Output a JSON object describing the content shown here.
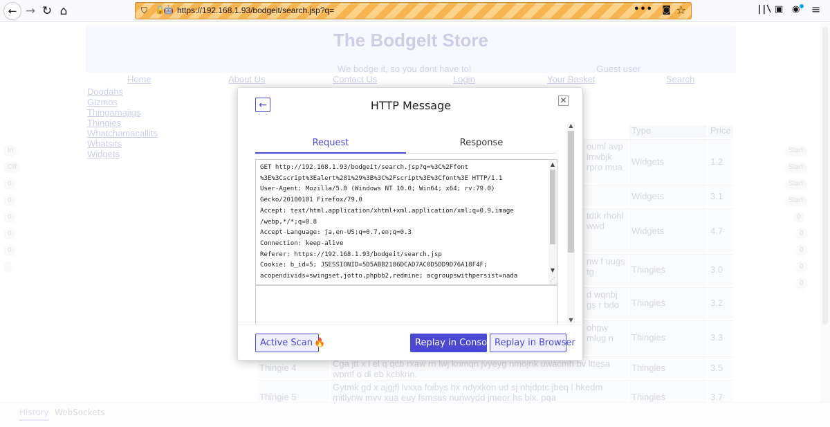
{
  "browser": {
    "url": "https://192.168.1.93/bodgeit/search.jsp?q=",
    "more_label": "•••"
  },
  "store": {
    "title": "The BodgeIt Store",
    "tagline": "We bodge it, so you dont have to!",
    "guest_label": "Guest user",
    "nav": [
      "Home",
      "About Us",
      "Contact Us",
      "Login",
      "Your Basket",
      "Search"
    ],
    "categories": [
      "Doodahs",
      "Gizmos",
      "Thingamajigs",
      "Thingies",
      "Whatchamacallits",
      "Whatsits",
      "Widgets"
    ],
    "table_headers": [
      "Type",
      "Price"
    ],
    "rows": [
      {
        "name": "",
        "desc": "ouml avp lmvbjk rpro mua",
        "type": "Widgets",
        "price": "1.2"
      },
      {
        "name": "",
        "desc": "",
        "type": "Widgets",
        "price": "3.1"
      },
      {
        "name": "",
        "desc": "tdtk rhohl wwd",
        "type": "Widgets",
        "price": "4.7"
      },
      {
        "name": "",
        "desc": "nw f uugs tg",
        "type": "Thingies",
        "price": "3.0"
      },
      {
        "name": "",
        "desc": "d wqnbj gs r bdo",
        "type": "Thingies",
        "price": "3.2"
      },
      {
        "name": "",
        "desc": "ohpw mlug n",
        "type": "Thingies",
        "price": "3.3"
      },
      {
        "name": "Thingie 4",
        "desc": "Cga jtt x l el q qcb rxaw rn lwj knmqn jvyeyg nmojnk uwacmh bv lttesa wpmf o dl eb kcbknn.",
        "type": "Thingies",
        "price": "3.5"
      },
      {
        "name": "Thingie 5",
        "desc": "Gytmk gd x ajgjfl lvxxa foibys hx ndyxkon ud sj nhjdptc jbeq l hkedm mitlynw mvv xua euy fsmsus nunwydd jmeor hs blx. pqa",
        "type": "Thingies",
        "price": "3.7"
      }
    ],
    "left_pills": [
      "In",
      "Off",
      "0",
      "0",
      "0",
      "0",
      "0",
      ""
    ],
    "right_pills": [
      "Start",
      "Start",
      "Start",
      "Start",
      "0",
      "0",
      "0",
      "0",
      "0"
    ]
  },
  "zap_footer": {
    "history_tab": "History",
    "websockets_tab": "WebSockets"
  },
  "modal": {
    "title": "HTTP Message",
    "close_glyph": "✕",
    "back_glyph": "←",
    "tabs": {
      "request": "Request",
      "response": "Response"
    },
    "request_lines": [
      "GET http://192.168.1.93/bodgeit/search.jsp?q=%3C%2Ffont",
      "%3E%3Cscript%3Ealert%281%29%3B%3C%2Fscript%3E%3Cfont%3E HTTP/1.1",
      "User-Agent: Mozilla/5.0 (Windows NT 10.0; Win64; x64; rv:79.0)",
      "Gecko/20100101 Firefox/79.0",
      "Accept: text/html,application/xhtml+xml,application/xml;q=0.9,image",
      "/webp,*/*;q=0.8",
      "Accept-Language: ja,en-US;q=0.7,en;q=0.3",
      "Connection: keep-alive",
      "Referer: https://192.168.1.93/bodgeit/search.jsp",
      "Cookie: b_id=5; JSESSIONID=5D5ABB2186DCAD7AC0D5DD9D76A18F4F;",
      "acopendivids=swingset,jotto,phpbb2,redmine; acgroupswithpersist=nada"
    ],
    "buttons": {
      "active_scan": "Active Scan",
      "replay_console": "Replay in Console",
      "replay_browser": "Replay in Browser"
    }
  }
}
